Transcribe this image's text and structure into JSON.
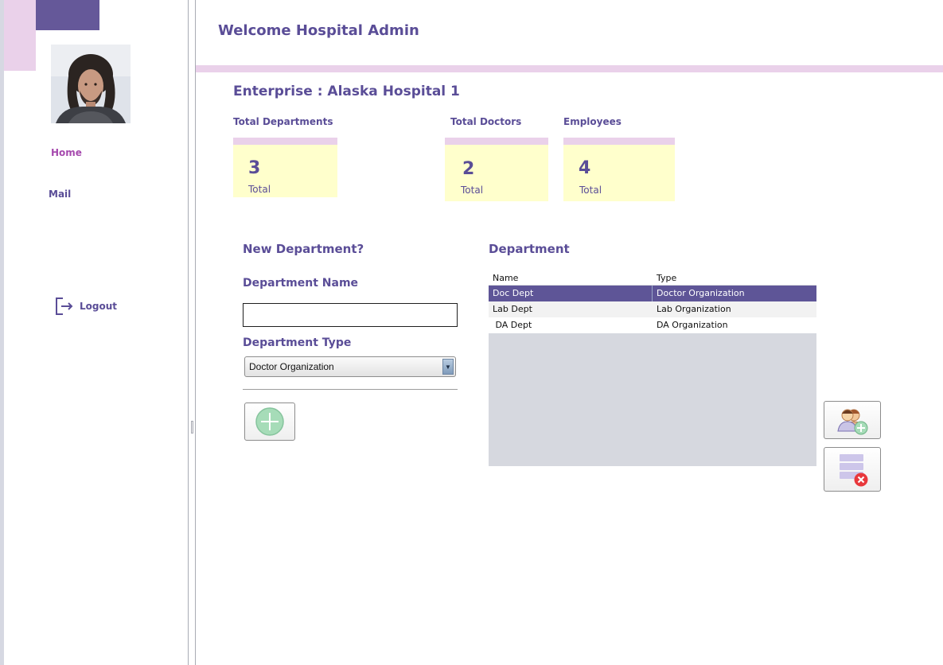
{
  "header": {
    "welcome": "Welcome Hospital Admin"
  },
  "sidebar": {
    "avatar_icon": "user-photo",
    "home": "Home",
    "mail": "Mail",
    "logout": "Logout",
    "logout_icon": "logout-icon"
  },
  "main": {
    "enterprise": "Enterprise : Alaska Hospital 1",
    "stats": [
      {
        "label": "Total Departments",
        "value": "3",
        "sub": "Total"
      },
      {
        "label": "Total Doctors",
        "value": "2",
        "sub": "Total"
      },
      {
        "label": "Employees",
        "value": "4",
        "sub": "Total"
      }
    ]
  },
  "form": {
    "title": "New Department?",
    "name_label": "Department Name",
    "name_value": "",
    "type_label": "Department Type",
    "type_value": "Doctor Organization",
    "add_icon": "add-circle-icon"
  },
  "table": {
    "title": "Department",
    "columns": [
      "Name",
      "Type"
    ],
    "rows": [
      {
        "name": "Doc Dept",
        "type": "Doctor Organization",
        "selected": true
      },
      {
        "name": "Lab Dept",
        "type": "Lab Organization",
        "selected": false
      },
      {
        "name": " DA Dept",
        "type": "DA Organization",
        "selected": false
      }
    ],
    "add_user_icon": "add-user-icon",
    "delete_icon": "delete-list-icon"
  },
  "colors": {
    "accent_purple": "#5e5597",
    "band_pink": "#ead1ea",
    "card_yellow": "#ffffcc",
    "home_magenta": "#a64aae"
  }
}
